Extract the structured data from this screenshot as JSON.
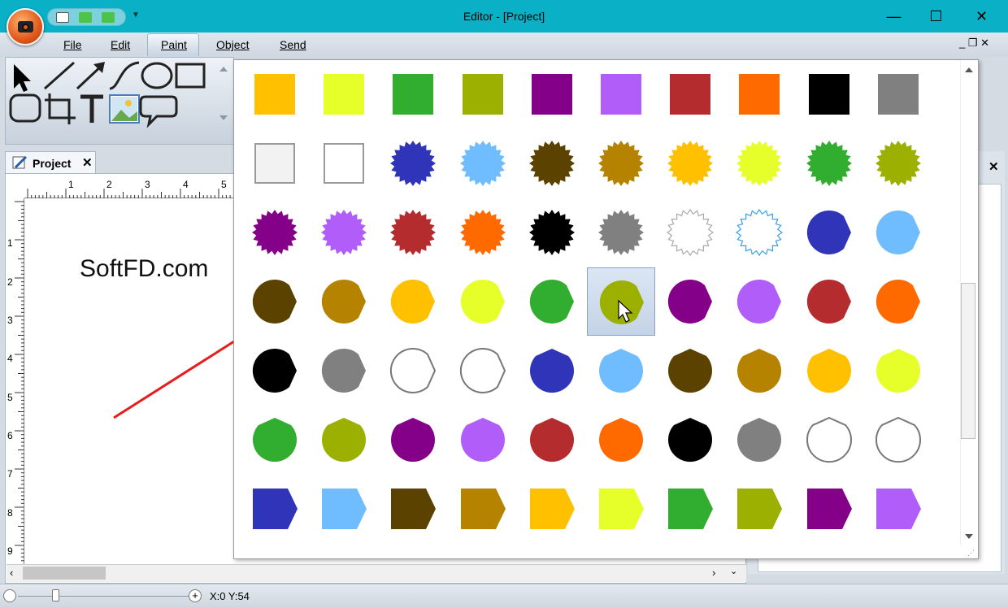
{
  "window": {
    "title": "Editor - [Project]",
    "buttons": {
      "minimize": "—",
      "maximize": "☐",
      "close": "✕"
    }
  },
  "menu": {
    "items": [
      {
        "label": "File",
        "id": "file"
      },
      {
        "label": "Edit",
        "id": "edit"
      },
      {
        "label": "Paint",
        "id": "paint"
      },
      {
        "label": "Object",
        "id": "object"
      },
      {
        "label": "Send",
        "id": "send"
      }
    ],
    "mdi_controls": "_ ❐ ✕"
  },
  "tools": [
    "pointer-icon",
    "line-icon",
    "arrow-icon",
    "curve-icon",
    "ellipse-icon",
    "rectangle-icon",
    "rounded-rect-icon",
    "crop-icon",
    "text-icon",
    "image-icon",
    "callout-icon"
  ],
  "project_tab": {
    "label": "Project",
    "close": "✕"
  },
  "ruler": {
    "h_ticks": [
      "1",
      "2",
      "3",
      "4",
      "5"
    ],
    "v_ticks": [
      "1",
      "2",
      "3",
      "4",
      "5",
      "6",
      "7",
      "8",
      "9"
    ]
  },
  "canvas": {
    "text": "SoftFD.com",
    "line_color": "#e81c1c"
  },
  "status": {
    "coords": "X:0 Y:54"
  },
  "gallery": {
    "selected_index": 35,
    "rows": [
      [
        {
          "s": "square",
          "c": "#ffc000"
        },
        {
          "s": "square",
          "c": "#e6ff2a"
        },
        {
          "s": "square",
          "c": "#31ad2f"
        },
        {
          "s": "square",
          "c": "#9bb000"
        },
        {
          "s": "square",
          "c": "#850088"
        },
        {
          "s": "square",
          "c": "#b05df9"
        },
        {
          "s": "square",
          "c": "#b52c2f"
        },
        {
          "s": "square",
          "c": "#ff6a00"
        },
        {
          "s": "square",
          "c": "#000000"
        },
        {
          "s": "square",
          "c": "#808080"
        }
      ],
      [
        {
          "s": "square-outline",
          "c": "#f2f2f2"
        },
        {
          "s": "square-outline",
          "c": "#ffffff"
        },
        {
          "s": "starburst",
          "c": "#2f34b8"
        },
        {
          "s": "starburst",
          "c": "#6fbcff"
        },
        {
          "s": "starburst",
          "c": "#5c4200"
        },
        {
          "s": "starburst",
          "c": "#b58300"
        },
        {
          "s": "starburst",
          "c": "#ffc000"
        },
        {
          "s": "starburst",
          "c": "#e6ff2a"
        },
        {
          "s": "starburst",
          "c": "#31ad2f"
        },
        {
          "s": "starburst",
          "c": "#9bb000"
        }
      ],
      [
        {
          "s": "starburst",
          "c": "#850088"
        },
        {
          "s": "starburst",
          "c": "#b05df9"
        },
        {
          "s": "starburst",
          "c": "#b52c2f"
        },
        {
          "s": "starburst",
          "c": "#ff6a00"
        },
        {
          "s": "starburst",
          "c": "#000000"
        },
        {
          "s": "starburst",
          "c": "#808080"
        },
        {
          "s": "starburst-outline",
          "c": "#ffffff"
        },
        {
          "s": "starburst-outline-blue",
          "c": "#ffffff"
        },
        {
          "s": "drop-right",
          "c": "#2f34b8"
        },
        {
          "s": "drop-right",
          "c": "#6fbcff"
        }
      ],
      [
        {
          "s": "drop-right",
          "c": "#5c4200"
        },
        {
          "s": "drop-right",
          "c": "#b58300"
        },
        {
          "s": "drop-right",
          "c": "#ffc000"
        },
        {
          "s": "drop-right",
          "c": "#e6ff2a"
        },
        {
          "s": "drop-right",
          "c": "#31ad2f"
        },
        {
          "s": "drop-right",
          "c": "#9bb000"
        },
        {
          "s": "drop-right",
          "c": "#850088"
        },
        {
          "s": "drop-right",
          "c": "#b05df9"
        },
        {
          "s": "drop-right",
          "c": "#b52c2f"
        },
        {
          "s": "drop-right",
          "c": "#ff6a00"
        }
      ],
      [
        {
          "s": "drop-right",
          "c": "#000000"
        },
        {
          "s": "drop-right",
          "c": "#808080"
        },
        {
          "s": "drop-right-outline",
          "c": "#ffffff"
        },
        {
          "s": "drop-right-outline",
          "c": "#ffffff"
        },
        {
          "s": "drop-up",
          "c": "#2f34b8"
        },
        {
          "s": "drop-up",
          "c": "#6fbcff"
        },
        {
          "s": "drop-up",
          "c": "#5c4200"
        },
        {
          "s": "drop-up",
          "c": "#b58300"
        },
        {
          "s": "drop-up",
          "c": "#ffc000"
        },
        {
          "s": "drop-up",
          "c": "#e6ff2a"
        }
      ],
      [
        {
          "s": "drop-up",
          "c": "#31ad2f"
        },
        {
          "s": "drop-up",
          "c": "#9bb000"
        },
        {
          "s": "drop-up",
          "c": "#850088"
        },
        {
          "s": "drop-up",
          "c": "#b05df9"
        },
        {
          "s": "drop-up",
          "c": "#b52c2f"
        },
        {
          "s": "drop-up",
          "c": "#ff6a00"
        },
        {
          "s": "drop-up",
          "c": "#000000"
        },
        {
          "s": "drop-up",
          "c": "#808080"
        },
        {
          "s": "drop-up-outline",
          "c": "#ffffff"
        },
        {
          "s": "drop-up-outline",
          "c": "#ffffff"
        }
      ],
      [
        {
          "s": "pentagon-arrow",
          "c": "#2f34b8"
        },
        {
          "s": "pentagon-arrow",
          "c": "#6fbcff"
        },
        {
          "s": "pentagon-arrow",
          "c": "#5c4200"
        },
        {
          "s": "pentagon-arrow",
          "c": "#b58300"
        },
        {
          "s": "pentagon-arrow",
          "c": "#ffc000"
        },
        {
          "s": "pentagon-arrow",
          "c": "#e6ff2a"
        },
        {
          "s": "pentagon-arrow",
          "c": "#31ad2f"
        },
        {
          "s": "pentagon-arrow",
          "c": "#9bb000"
        },
        {
          "s": "pentagon-arrow",
          "c": "#850088"
        },
        {
          "s": "pentagon-arrow",
          "c": "#b05df9"
        }
      ]
    ]
  }
}
